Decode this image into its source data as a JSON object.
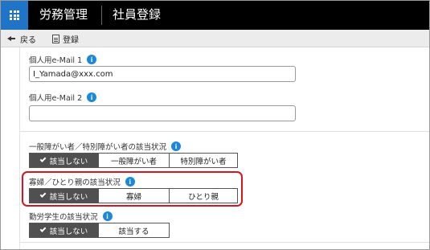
{
  "header": {
    "app_name": "労務管理",
    "page_title": "社員登録",
    "app_icon": "grid-icon"
  },
  "toolbar": {
    "back_label": "戻る",
    "save_label": "登録"
  },
  "fields": {
    "email1": {
      "label": "個人用e-Mail 1",
      "value": "I_Yamada@xxx.com"
    },
    "email2": {
      "label": "個人用e-Mail 2",
      "value": ""
    },
    "disability": {
      "label": "一般障がい者／特別障がい者の該当状況",
      "options": [
        "該当しない",
        "一般障がい者",
        "特別障がい者"
      ],
      "selected": "該当しない"
    },
    "widow": {
      "label": "寡婦／ひとり親の該当状況",
      "options": [
        "該当しない",
        "寡婦",
        "ひとり親"
      ],
      "selected": "該当しない"
    },
    "student": {
      "label": "勤労学生の該当状況",
      "options": [
        "該当しない",
        "該当する"
      ],
      "selected": "該当しない"
    }
  },
  "info_icon_glyph": "i",
  "colors": {
    "header_bg": "#000000",
    "app_button": "#1f74c8",
    "info": "#1e88d8",
    "selected_segment": "#505050",
    "highlight": "#d9141c"
  }
}
